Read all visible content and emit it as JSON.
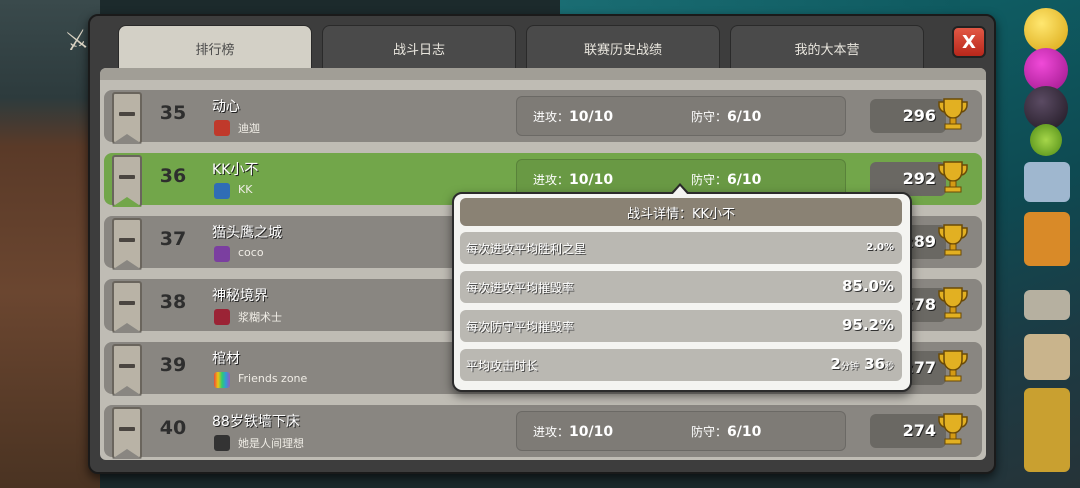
{
  "tabs": [
    {
      "label": "排行榜"
    },
    {
      "label": "战斗日志"
    },
    {
      "label": "联赛历史战绩"
    },
    {
      "label": "我的大本营"
    }
  ],
  "close_label": "X",
  "rows": [
    {
      "rank": "35",
      "name": "动心",
      "clan": "迪迦",
      "attack_label": "进攻：",
      "attack": "10/10",
      "defense_label": "防守：",
      "defense": "6/10",
      "trophies": "296",
      "clan_color": "#c0392b"
    },
    {
      "rank": "36",
      "name": "KK小不",
      "clan": "KK",
      "attack_label": "进攻：",
      "attack": "10/10",
      "defense_label": "防守：",
      "defense": "6/10",
      "trophies": "292",
      "clan_color": "#2f6db5"
    },
    {
      "rank": "37",
      "name": "猫头鹰之城",
      "clan": "coco",
      "attack_label": "",
      "attack": "",
      "defense_label": "",
      "defense": "",
      "trophies": "289",
      "clan_color": "#7b3fa0"
    },
    {
      "rank": "38",
      "name": "神秘境界",
      "clan": "浆糊术士",
      "attack_label": "",
      "attack": "",
      "defense_label": "",
      "defense": "",
      "trophies": "278",
      "clan_color": "#9b2335"
    },
    {
      "rank": "39",
      "name": "棺材",
      "clan": "Friends zone",
      "attack_label": "",
      "attack": "",
      "defense_label": "",
      "defense": "",
      "trophies": "277",
      "clan_color": "#3aa05a"
    },
    {
      "rank": "40",
      "name": "88岁铁墙下床",
      "clan": "她是人间理想",
      "attack_label": "进攻：",
      "attack": "10/10",
      "defense_label": "防守：",
      "defense": "6/10",
      "trophies": "274",
      "clan_color": "#333333"
    }
  ],
  "popup": {
    "title": "战斗详情：KK小不",
    "stats": [
      {
        "label": "每次进攻平均胜利之星",
        "value": "2.0%"
      },
      {
        "label": "每次进攻平均摧毁率",
        "value": "85.0%"
      },
      {
        "label": "每次防守平均摧毁率",
        "value": "95.2%"
      },
      {
        "label": "平均攻击时长",
        "value_min": "2",
        "min_unit": "分钟",
        "value_sec": "36",
        "sec_unit": "秒"
      }
    ]
  },
  "colors": {
    "highlight_row": "#72a64a",
    "row": "#898681",
    "close": "#d2382a"
  }
}
